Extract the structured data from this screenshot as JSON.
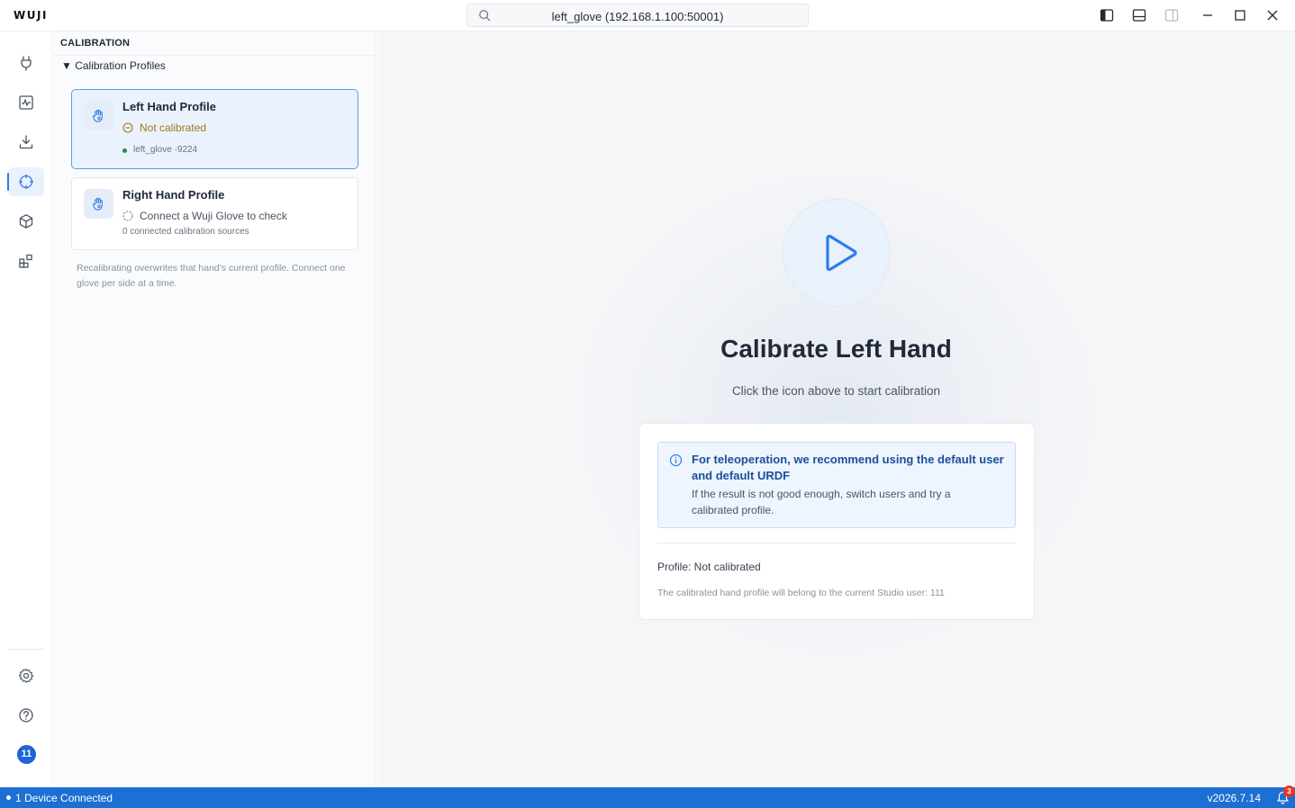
{
  "app": {
    "logo_text": "WUJI",
    "search_text": "left_glove (192.168.1.100:50001)"
  },
  "activity_bar": {
    "items": [
      {
        "icon": "plug-icon",
        "active": false
      },
      {
        "icon": "activity-monitor-icon",
        "active": false
      },
      {
        "icon": "download-icon",
        "active": false
      },
      {
        "icon": "crosshair-icon",
        "active": true
      },
      {
        "icon": "cube-icon",
        "active": false
      },
      {
        "icon": "extensions-icon",
        "active": false
      }
    ],
    "bottom": [
      {
        "icon": "settings-gear-icon"
      },
      {
        "icon": "help-icon"
      }
    ],
    "avatar_label": "11"
  },
  "sidebar": {
    "title": "CALIBRATION",
    "section_label": "▼ Calibration Profiles",
    "profiles": [
      {
        "title": "Left Hand Profile",
        "status": "Not calibrated",
        "device": "left_glove ·9224",
        "selected": true
      },
      {
        "title": "Right Hand Profile",
        "status": "Connect a Wuji Glove to check",
        "sources": "0 connected calibration sources",
        "selected": false
      }
    ],
    "note": "Recalibrating overwrites that hand's current profile. Connect one glove per side at a time."
  },
  "main": {
    "title": "Calibrate Left Hand",
    "subtitle": "Click the icon above to start calibration",
    "info_title": "For teleoperation, we recommend using the default user and default URDF",
    "info_body": "If the result is not good enough, switch users and try a calibrated profile.",
    "profile_line": "Profile: Not calibrated",
    "owner_line": "The calibrated hand profile will belong to the current Studio user: 111"
  },
  "statusbar": {
    "devices": "1 Device Connected",
    "version": "v2026.7.14",
    "notification_count": "3"
  },
  "colors": {
    "accent": "#1c6fd3",
    "warning": "#a07a12",
    "info_title": "#1a4f9c"
  }
}
